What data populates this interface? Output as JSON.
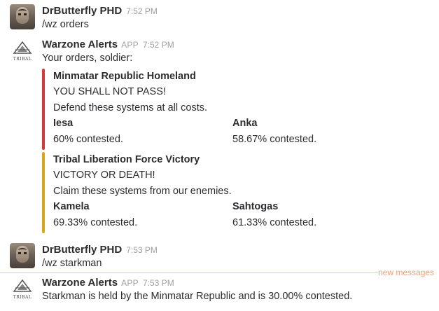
{
  "messages": [
    {
      "author": "DrButterfly PHD",
      "time": "7:52 PM",
      "text": "/wz orders"
    },
    {
      "author": "Warzone Alerts",
      "badge": "APP",
      "time": "7:52 PM",
      "text": "Your orders, soldier:",
      "attachments": [
        {
          "color": "#d13b3b",
          "title": "Minmatar Republic Homeland",
          "pretext": "YOU SHALL NOT PASS!",
          "text": "Defend these systems at all costs.",
          "fields": [
            {
              "title": "Iesa",
              "value": "60% contested."
            },
            {
              "title": "Anka",
              "value": "58.67% contested."
            }
          ]
        },
        {
          "color": "#d8a51f",
          "title": "Tribal Liberation Force Victory",
          "pretext": "VICTORY OR DEATH!",
          "text": "Claim these systems from our enemies.",
          "fields": [
            {
              "title": "Kamela",
              "value": "69.33% contested."
            },
            {
              "title": "Sahtogas",
              "value": "61.33% contested."
            }
          ]
        }
      ]
    },
    {
      "author": "DrButterfly PHD",
      "time": "7:53 PM",
      "text": "/wz starkman"
    },
    {
      "author": "Warzone Alerts",
      "badge": "APP",
      "time": "7:53 PM",
      "text": "Starkman is held by the Minmatar Republic and is 30.00% contested."
    }
  ],
  "divider": {
    "label": "new messages"
  },
  "logo_text": "TRIBAL"
}
